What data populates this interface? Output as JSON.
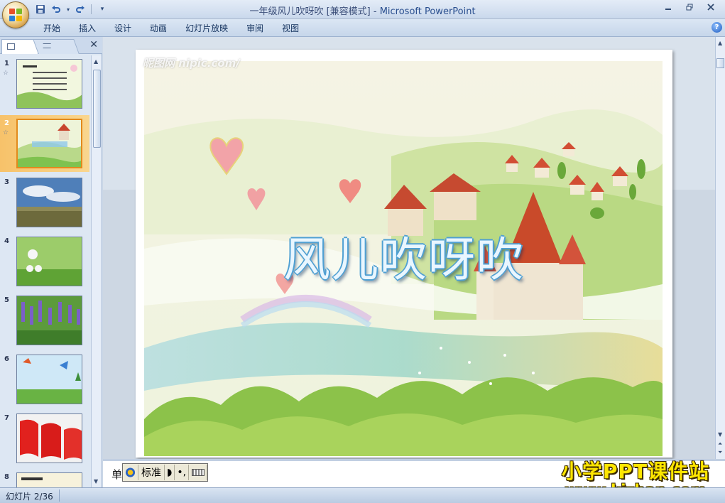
{
  "window": {
    "title_doc": "一年级风儿吹呀吹 [兼容模式]",
    "title_sep": " - ",
    "title_app": "Microsoft PowerPoint"
  },
  "ribbon": {
    "tabs": [
      "开始",
      "插入",
      "设计",
      "动画",
      "幻灯片放映",
      "审阅",
      "视图"
    ],
    "help": "?"
  },
  "slides_pane": {
    "thumbs": [
      {
        "num": "1",
        "star": "☆",
        "kind": "text-slide"
      },
      {
        "num": "2",
        "star": "☆",
        "kind": "title-slide",
        "selected": true
      },
      {
        "num": "3",
        "kind": "sky-field"
      },
      {
        "num": "4",
        "kind": "dandelion"
      },
      {
        "num": "5",
        "kind": "lavender"
      },
      {
        "num": "6",
        "kind": "kites"
      },
      {
        "num": "7",
        "kind": "flags"
      },
      {
        "num": "8",
        "kind": "text-slide"
      }
    ]
  },
  "slide": {
    "title": "风儿吹呀吹",
    "watermark": "昵图网 nipic.com/"
  },
  "notes": {
    "label": "单"
  },
  "ime_toolbar": {
    "mode": "标准"
  },
  "branding": {
    "line1": "小学PPT课件站",
    "line2": "www.kjzhan.com"
  },
  "status": {
    "slide_counter": "幻灯片 2/36"
  },
  "colors": {
    "accent_selection": "#f7c26a",
    "title_outline": "#4fa0d3",
    "brand_yellow": "#ffe600"
  }
}
